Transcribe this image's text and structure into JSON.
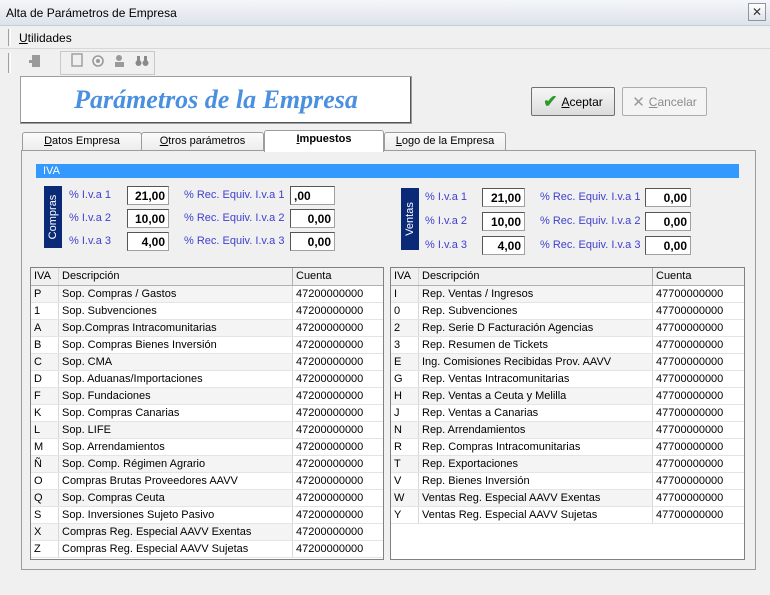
{
  "window": {
    "title": "Alta de Parámetros de Empresa",
    "close_glyph": "✕"
  },
  "menu": {
    "utilidades_u": "U",
    "utilidades_rest": "tilidades"
  },
  "toolbar": {
    "icons": [
      "exit-icon",
      "document-icon",
      "preview-icon",
      "user-icon",
      "binoculars-icon"
    ]
  },
  "header": {
    "title": "Parámetros de la Empresa"
  },
  "buttons": {
    "accept_u": "A",
    "accept_rest": "ceptar",
    "cancel_u": "C",
    "cancel_rest": "ancelar"
  },
  "tabs": [
    {
      "label_u": "D",
      "label_rest": "atos Empresa"
    },
    {
      "label_u": "O",
      "label_rest": "tros parámetros"
    },
    {
      "label_u": "I",
      "label_rest": "mpuestos"
    },
    {
      "label_u": "L",
      "label_rest": "ogo de la Empresa"
    }
  ],
  "active_tab": "Impuestos",
  "iva_section": "IVA",
  "compras": {
    "label": "Compras",
    "iva1_label": "% I.v.a 1",
    "iva1": "21,00",
    "iva2_label": "% I.v.a 2",
    "iva2": "10,00",
    "iva3_label": "% I.v.a 3",
    "iva3": "4,00",
    "rec1_label": "% Rec. Equiv. I.v.a 1",
    "rec1": ",00",
    "rec2_label": "% Rec. Equiv. I.v.a 2",
    "rec2": "0,00",
    "rec3_label": "% Rec. Equiv. I.v.a 3",
    "rec3": "0,00"
  },
  "ventas": {
    "label": "Ventas",
    "iva1_label": "% I.v.a 1",
    "iva1": "21,00",
    "iva2_label": "% I.v.a 2",
    "iva2": "10,00",
    "iva3_label": "% I.v.a 3",
    "iva3": "4,00",
    "rec1_label": "% Rec. Equiv. I.v.a 1",
    "rec1": "0,00",
    "rec2_label": "% Rec. Equiv. I.v.a 2",
    "rec2": "0,00",
    "rec3_label": "% Rec. Equiv. I.v.a 3",
    "rec3": "0,00"
  },
  "table_headers": {
    "iva": "IVA",
    "desc": "Descripción",
    "cuenta": "Cuenta"
  },
  "compras_rows": [
    {
      "iva": "P",
      "desc": "Sop. Compras / Gastos",
      "cuenta": "47200000000"
    },
    {
      "iva": "1",
      "desc": "Sop. Subvenciones",
      "cuenta": "47200000000"
    },
    {
      "iva": "A",
      "desc": "Sop.Compras Intracomunitarias",
      "cuenta": "47200000000"
    },
    {
      "iva": "B",
      "desc": "Sop. Compras Bienes Inversión",
      "cuenta": "47200000000"
    },
    {
      "iva": "C",
      "desc": "Sop. CMA",
      "cuenta": "47200000000"
    },
    {
      "iva": "D",
      "desc": "Sop. Aduanas/Importaciones",
      "cuenta": "47200000000"
    },
    {
      "iva": "F",
      "desc": "Sop. Fundaciones",
      "cuenta": "47200000000"
    },
    {
      "iva": "K",
      "desc": "Sop. Compras Canarias",
      "cuenta": "47200000000"
    },
    {
      "iva": "L",
      "desc": "Sop. LIFE",
      "cuenta": "47200000000"
    },
    {
      "iva": "M",
      "desc": "Sop. Arrendamientos",
      "cuenta": "47200000000"
    },
    {
      "iva": "Ñ",
      "desc": "Sop. Comp. Régimen Agrario",
      "cuenta": "47200000000"
    },
    {
      "iva": "O",
      "desc": "Compras Brutas Proveedores AAVV",
      "cuenta": "47200000000"
    },
    {
      "iva": "Q",
      "desc": "Sop. Compras Ceuta",
      "cuenta": "47200000000"
    },
    {
      "iva": "S",
      "desc": "Sop. Inversiones Sujeto Pasivo",
      "cuenta": "47200000000"
    },
    {
      "iva": "X",
      "desc": "Compras Reg. Especial AAVV Exentas",
      "cuenta": "47200000000"
    },
    {
      "iva": "Z",
      "desc": "Compras Reg. Especial AAVV Sujetas",
      "cuenta": "47200000000"
    }
  ],
  "ventas_rows": [
    {
      "iva": "I",
      "desc": "Rep. Ventas / Ingresos",
      "cuenta": "47700000000"
    },
    {
      "iva": "0",
      "desc": "Rep. Subvenciones",
      "cuenta": "47700000000"
    },
    {
      "iva": "2",
      "desc": "Rep. Serie D Facturación Agencias",
      "cuenta": "47700000000"
    },
    {
      "iva": "3",
      "desc": "Rep. Resumen de Tickets",
      "cuenta": "47700000000"
    },
    {
      "iva": "E",
      "desc": "Ing. Comisiones Recibidas Prov. AAVV",
      "cuenta": "47700000000"
    },
    {
      "iva": "G",
      "desc": "Rep. Ventas Intracomunitarias",
      "cuenta": "47700000000"
    },
    {
      "iva": "H",
      "desc": "Rep. Ventas a Ceuta y Melilla",
      "cuenta": "47700000000"
    },
    {
      "iva": "J",
      "desc": "Rep. Ventas a Canarias",
      "cuenta": "47700000000"
    },
    {
      "iva": "N",
      "desc": "Rep. Arrendamientos",
      "cuenta": "47700000000"
    },
    {
      "iva": "R",
      "desc": "Rep. Compras Intracomunitarias",
      "cuenta": "47700000000"
    },
    {
      "iva": "T",
      "desc": "Rep. Exportaciones",
      "cuenta": "47700000000"
    },
    {
      "iva": "V",
      "desc": "Rep. Bienes Inversión",
      "cuenta": "47700000000"
    },
    {
      "iva": "W",
      "desc": "Ventas Reg. Especial AAVV Exentas",
      "cuenta": "47700000000"
    },
    {
      "iva": "Y",
      "desc": "Ventas Reg. Especial AAVV Sujetas",
      "cuenta": "47700000000"
    }
  ]
}
